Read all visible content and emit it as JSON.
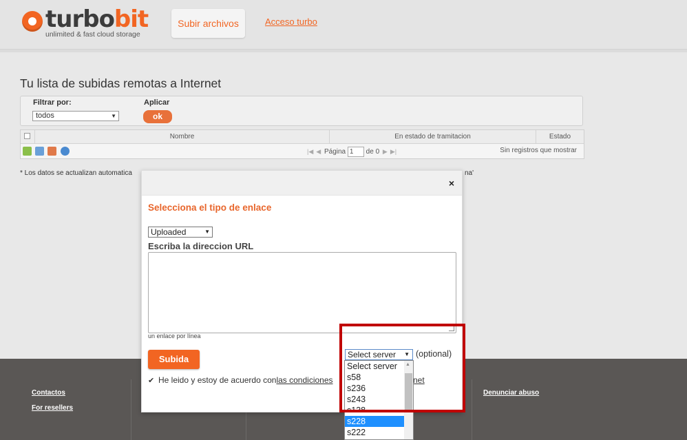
{
  "header": {
    "logo_prefix": "turbo",
    "logo_suffix": "bit",
    "logo_tagline": "unlimited & fast cloud storage",
    "nav": {
      "upload": "Subir archivos",
      "turbo": "Acceso turbo"
    }
  },
  "page": {
    "title": "Tu lista de subidas remotas a Internet",
    "filter": {
      "label": "Filtrar por:",
      "value": "todos",
      "apply_label": "Aplicar",
      "ok": "ok"
    },
    "grid": {
      "columns": [
        "Nombre",
        "En estado de tramitacion",
        "Estado"
      ],
      "pager": {
        "page_label": "Página",
        "page_value": "1",
        "of": "de 0"
      },
      "no_records": "Sin registros que mostrar",
      "icons": [
        "add-icon",
        "refresh-icon",
        "delete-icon",
        "reload-icon"
      ]
    },
    "note": "* Los datos se actualizan automatica",
    "note_tail": "na'"
  },
  "footer": {
    "contacts": "Contactos",
    "resellers": "For resellers",
    "report": "Denunciar abuso"
  },
  "modal": {
    "close": "×",
    "title": "Selecciona el tipo de enlace",
    "type_value": "Uploaded",
    "url_label": "Escriba la direccion URL",
    "url_value": "",
    "url_hint": "un enlace por línea",
    "submit": "Subida",
    "agree_prefix": "He leido y estoy de acuerdo con",
    "agree_link": "las condiciones",
    "agree_tail": "net",
    "server_select": "Select server",
    "optional": "(optional)",
    "server_options": [
      "Select server",
      "s58",
      "s236",
      "s243",
      "s138",
      "s228",
      "s222"
    ],
    "server_selected": "s228"
  },
  "colors": {
    "brand": "#f26522",
    "highlight": "#c00000",
    "selection": "#1e90ff",
    "footer": "#5a5755"
  }
}
